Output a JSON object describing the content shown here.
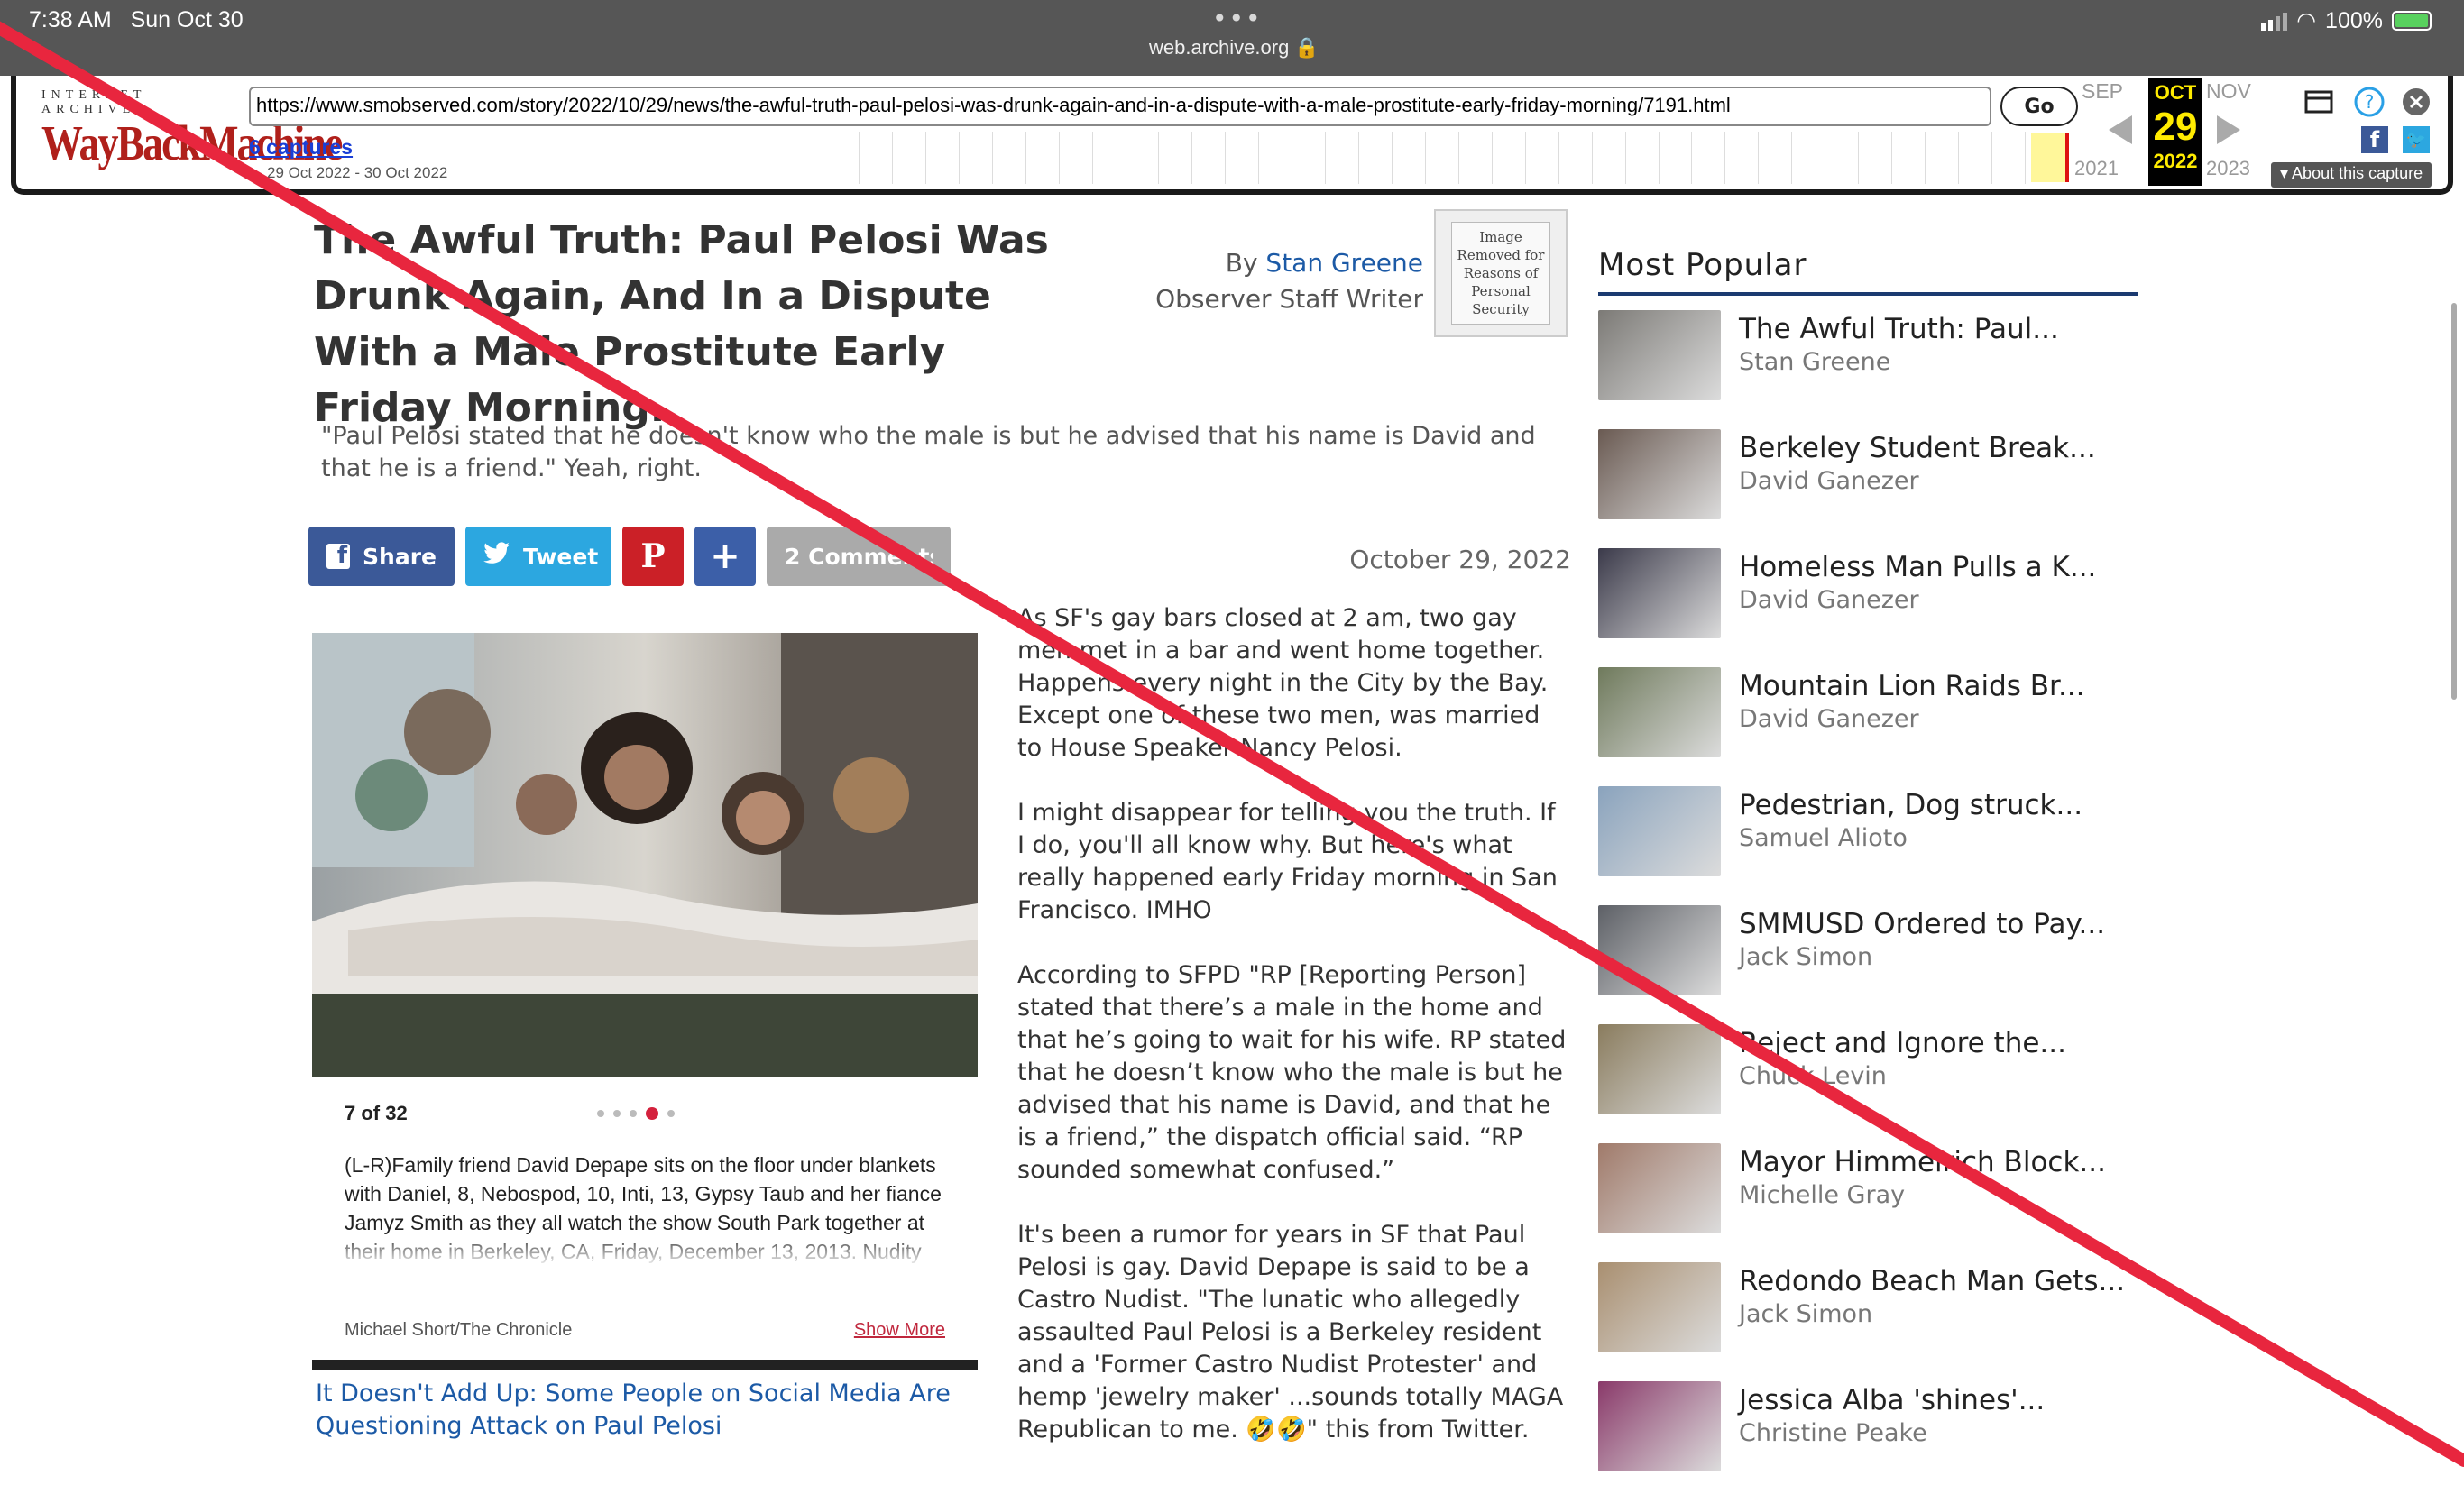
{
  "status_bar": {
    "time": "7:38 AM",
    "date": "Sun Oct 30",
    "domain": "web.archive.org",
    "battery": "100%"
  },
  "wayback": {
    "logo_top": "INTERNET ARCHIVE",
    "logo_main": "WayBackMachine",
    "url": "https://www.smobserved.com/story/2022/10/29/news/the-awful-truth-paul-pelosi-was-drunk-again-and-in-a-dispute-with-a-male-prostitute-early-friday-morning/7191.html",
    "go_label": "Go",
    "captures": "6 captures",
    "range": "29 Oct 2022 - 30 Oct 2022",
    "prev_month": "SEP",
    "cur_month": "OCT",
    "next_month": "NOV",
    "cur_day": "29",
    "prev_year": "2021",
    "cur_year": "2022",
    "next_year": "2023",
    "about": "About this capture"
  },
  "article": {
    "title": "The Awful Truth: Paul Pelosi Was Drunk Again, And In a Dispute With a Male Prostitute Early Friday Morning.",
    "by_prefix": "By",
    "author": "Stan Greene",
    "author_role": "Observer Staff Writer",
    "author_image_text": "Image Removed for Reasons of Personal Security",
    "teaser": "\"Paul Pelosi stated that he doesn't know who the male is but he advised that his name is David and that he is a friend.\" Yeah, right.",
    "date": "October 29, 2022",
    "share": {
      "facebook": "Share",
      "twitter": "Tweet",
      "comments": "2 Comments"
    },
    "photo": {
      "counter": "7 of 32",
      "caption": "(L-R)Family friend David Depape sits on the floor under blankets with Daniel, 8, Nebospod, 10, Inti, 13, Gypsy Taub and her fiance Jamyz Smith as they all watch the show South Park together at their home in Berkeley, CA, Friday, December 13, 2013. Nudity activists Gypsy Taub and her",
      "credit": "Michael Short/The Chronicle",
      "show_more": "Show More"
    },
    "related_link": "It Doesn't Add Up: Some People on Social Media Are Questioning Attack on Paul Pelosi",
    "paragraphs": [
      "As SF's gay bars closed at 2 am, two gay men met in a bar and went home together. Happens every night in the City by the Bay. Except one of these two men, was married to House Speaker Nancy Pelosi.",
      "I might disappear for telling you the truth. If I do, you'll all know why. But here's what really happened early Friday morning in San Francisco. IMHO",
      "According to SFPD \"RP [Reporting Person] stated that there’s a male in the home and that he’s going to wait for his wife. RP stated that he doesn’t know who the male is but he advised that his name is David, and that he is a friend,” the dispatch official said. “RP sounded somewhat confused.”",
      "It's been a rumor for years in SF that Paul Pelosi is gay. David Depape is said to be a Castro Nudist. \"The lunatic who allegedly assaulted Paul Pelosi is a Berkeley resident and a 'Former Castro Nudist Protester' and hemp 'jewelry maker' ...sounds totally MAGA Republican to me. 🤣🤣\" this from Twitter."
    ]
  },
  "sidebar": {
    "title": "Most Popular",
    "items": [
      {
        "headline": "The Awful Truth: Paul...",
        "author": "Stan Greene",
        "thumb": "#7c7a76"
      },
      {
        "headline": "Berkeley Student Break...",
        "author": "David Ganezer",
        "thumb": "#6a5a52"
      },
      {
        "headline": "Homeless Man Pulls a K...",
        "author": "David Ganezer",
        "thumb": "#3b3a4a"
      },
      {
        "headline": "Mountain Lion Raids Br...",
        "author": "David Ganezer",
        "thumb": "#6f7a5c"
      },
      {
        "headline": "Pedestrian, Dog struck...",
        "author": "Samuel Alioto",
        "thumb": "#8aa3bd"
      },
      {
        "headline": "SMMUSD Ordered to Pay...",
        "author": "Jack Simon",
        "thumb": "#5d6066"
      },
      {
        "headline": "Reject and Ignore the...",
        "author": "Chuck Levin",
        "thumb": "#8a7c5e"
      },
      {
        "headline": "Mayor Himmelrich Block...",
        "author": "Michelle Gray",
        "thumb": "#a07a6a"
      },
      {
        "headline": "Redondo Beach Man Gets...",
        "author": "Jack Simon",
        "thumb": "#a98f70"
      },
      {
        "headline": "Jessica Alba 'shines'...",
        "author": "Christine Peake",
        "thumb": "#8a3a6a"
      }
    ]
  },
  "colors": {
    "strike_line": "#e8263e",
    "link": "#1c5aa6",
    "sidebar_rule": "#1b3a70"
  }
}
